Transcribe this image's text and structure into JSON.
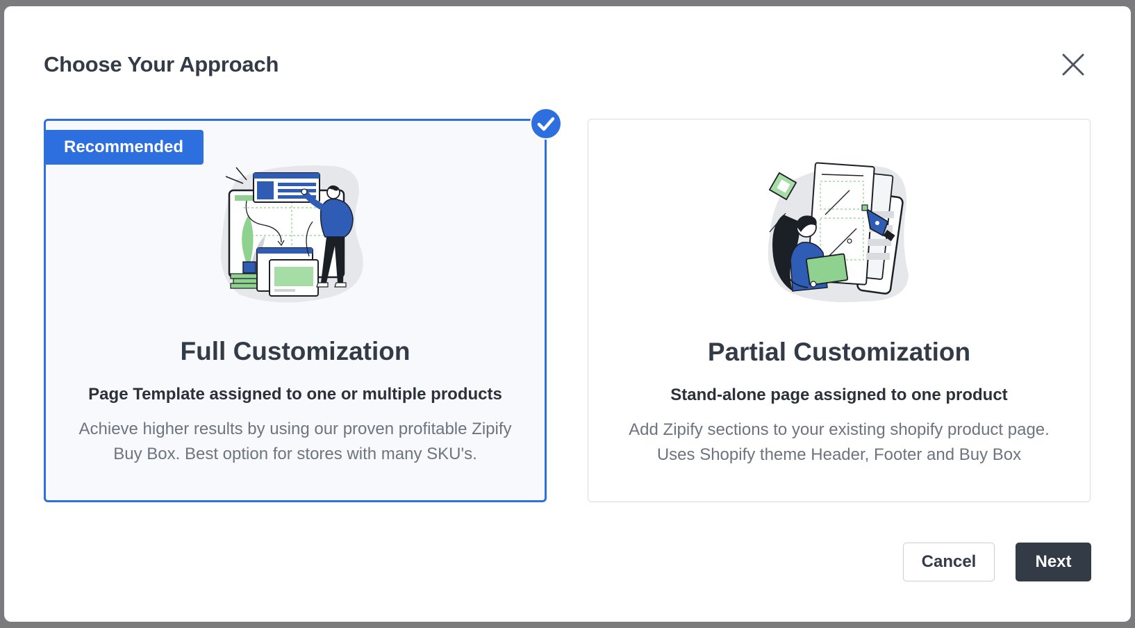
{
  "dialog": {
    "title": "Choose Your Approach",
    "close_icon": "close-icon"
  },
  "options": [
    {
      "badge": "Recommended",
      "title": "Full Customization",
      "subtitle": "Page Template assigned to one or multiple products",
      "description": "Achieve higher results by using our proven profitable Zipify Buy Box. Best option for stores with many SKU's.",
      "selected": true,
      "illustration_icon": "page-builder-illustration"
    },
    {
      "title": "Partial Customization",
      "subtitle": "Stand-alone page assigned to one product",
      "description": "Add Zipify sections to your existing shopify product page. Uses Shopify theme Header, Footer and Buy Box",
      "selected": false,
      "illustration_icon": "designer-tablet-illustration"
    }
  ],
  "footer": {
    "cancel_label": "Cancel",
    "next_label": "Next"
  },
  "colors": {
    "accent": "#2e6fe0",
    "primary_button": "#333b47",
    "text_dark": "#333b47",
    "text_muted": "#6d7480",
    "illustration_green": "#8fd18f",
    "illustration_blue": "#2f5db5",
    "overlay": "#7b7b7d"
  }
}
